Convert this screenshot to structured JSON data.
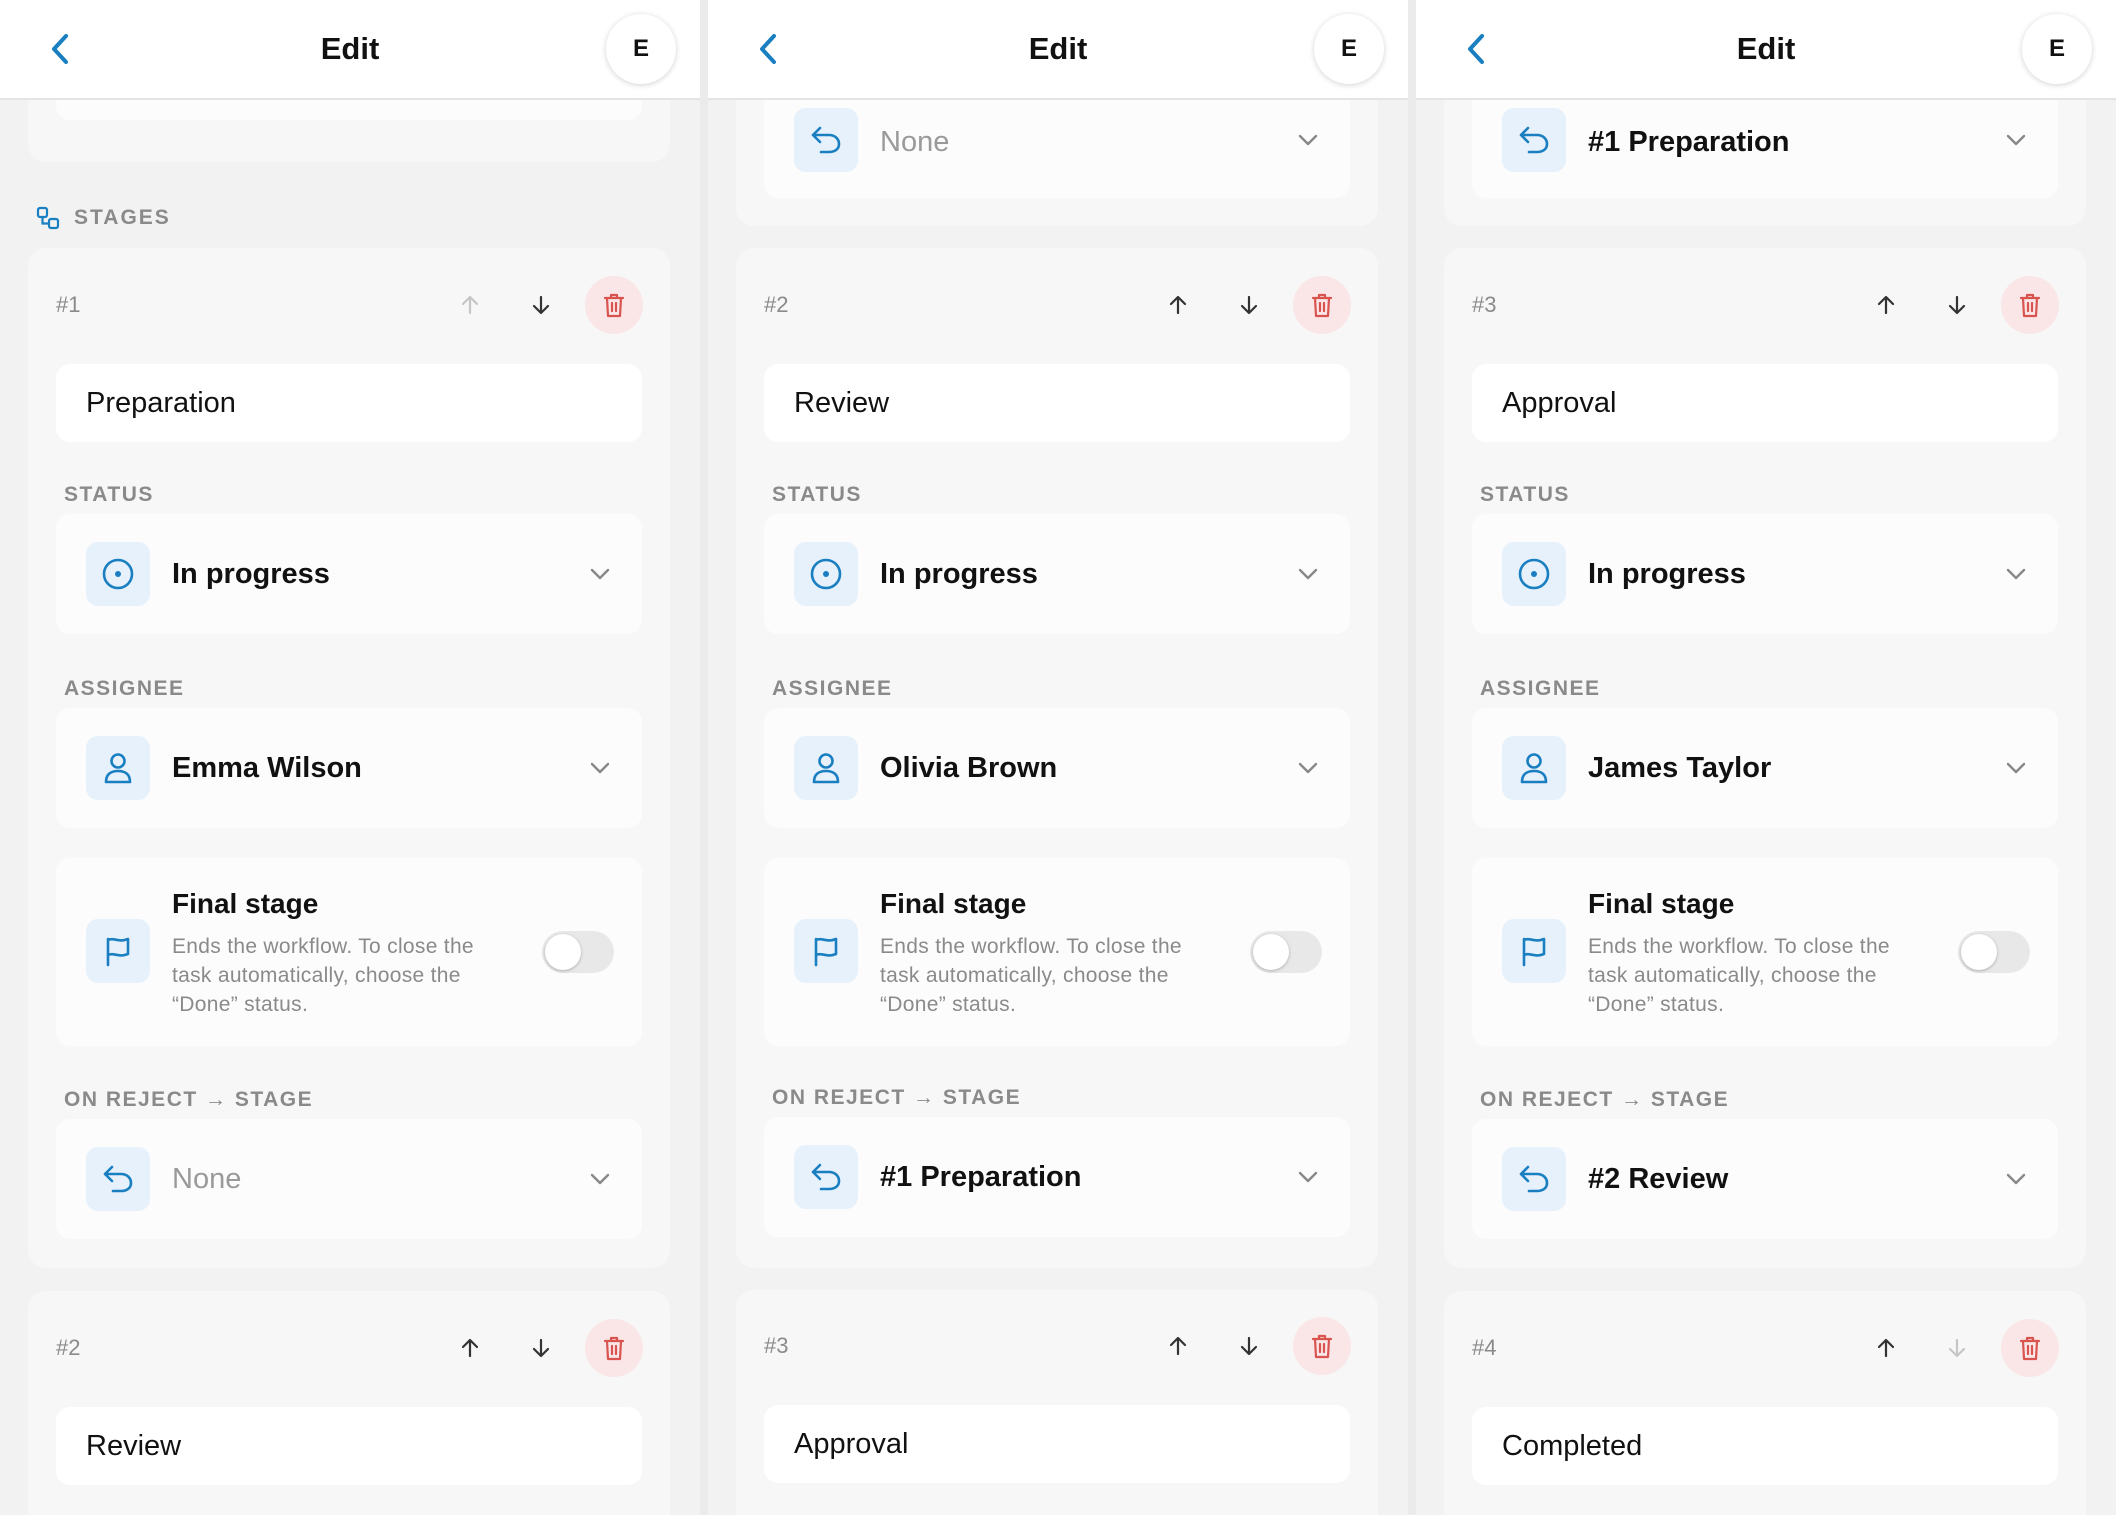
{
  "header": {
    "title": "Edit",
    "avatar_initial": "E"
  },
  "labels": {
    "stages": "STAGES",
    "status": "STATUS",
    "assignee": "ASSIGNEE",
    "on_reject": "ON REJECT → STAGE",
    "final_title": "Final stage",
    "final_desc": "Ends the workflow. To close the task automatically, choose the “Done” status."
  },
  "panels": [
    {
      "top_reject_value": "",
      "stage": {
        "num": "#1",
        "name": "Preparation",
        "status": "In progress",
        "assignee": "Emma Wilson",
        "on_reject": "None",
        "final_stage": false
      },
      "next": {
        "num": "#2",
        "name": "Review"
      }
    },
    {
      "top_reject_value": "None",
      "stage": {
        "num": "#2",
        "name": "Review",
        "status": "In progress",
        "assignee": "Olivia Brown",
        "on_reject": "#1 Preparation",
        "final_stage": false
      },
      "next": {
        "num": "#3",
        "name": "Approval"
      }
    },
    {
      "top_reject_value": "#1 Preparation",
      "stage": {
        "num": "#3",
        "name": "Approval",
        "status": "In progress",
        "assignee": "James Taylor",
        "on_reject": "#2 Review",
        "final_stage": false
      },
      "next": {
        "num": "#4",
        "name": "Completed"
      }
    }
  ],
  "colors": {
    "accent": "#1a7fc1",
    "icon_bg": "#e6f1fb",
    "delete": "#d9534f",
    "delete_bg": "#fae6e6"
  }
}
